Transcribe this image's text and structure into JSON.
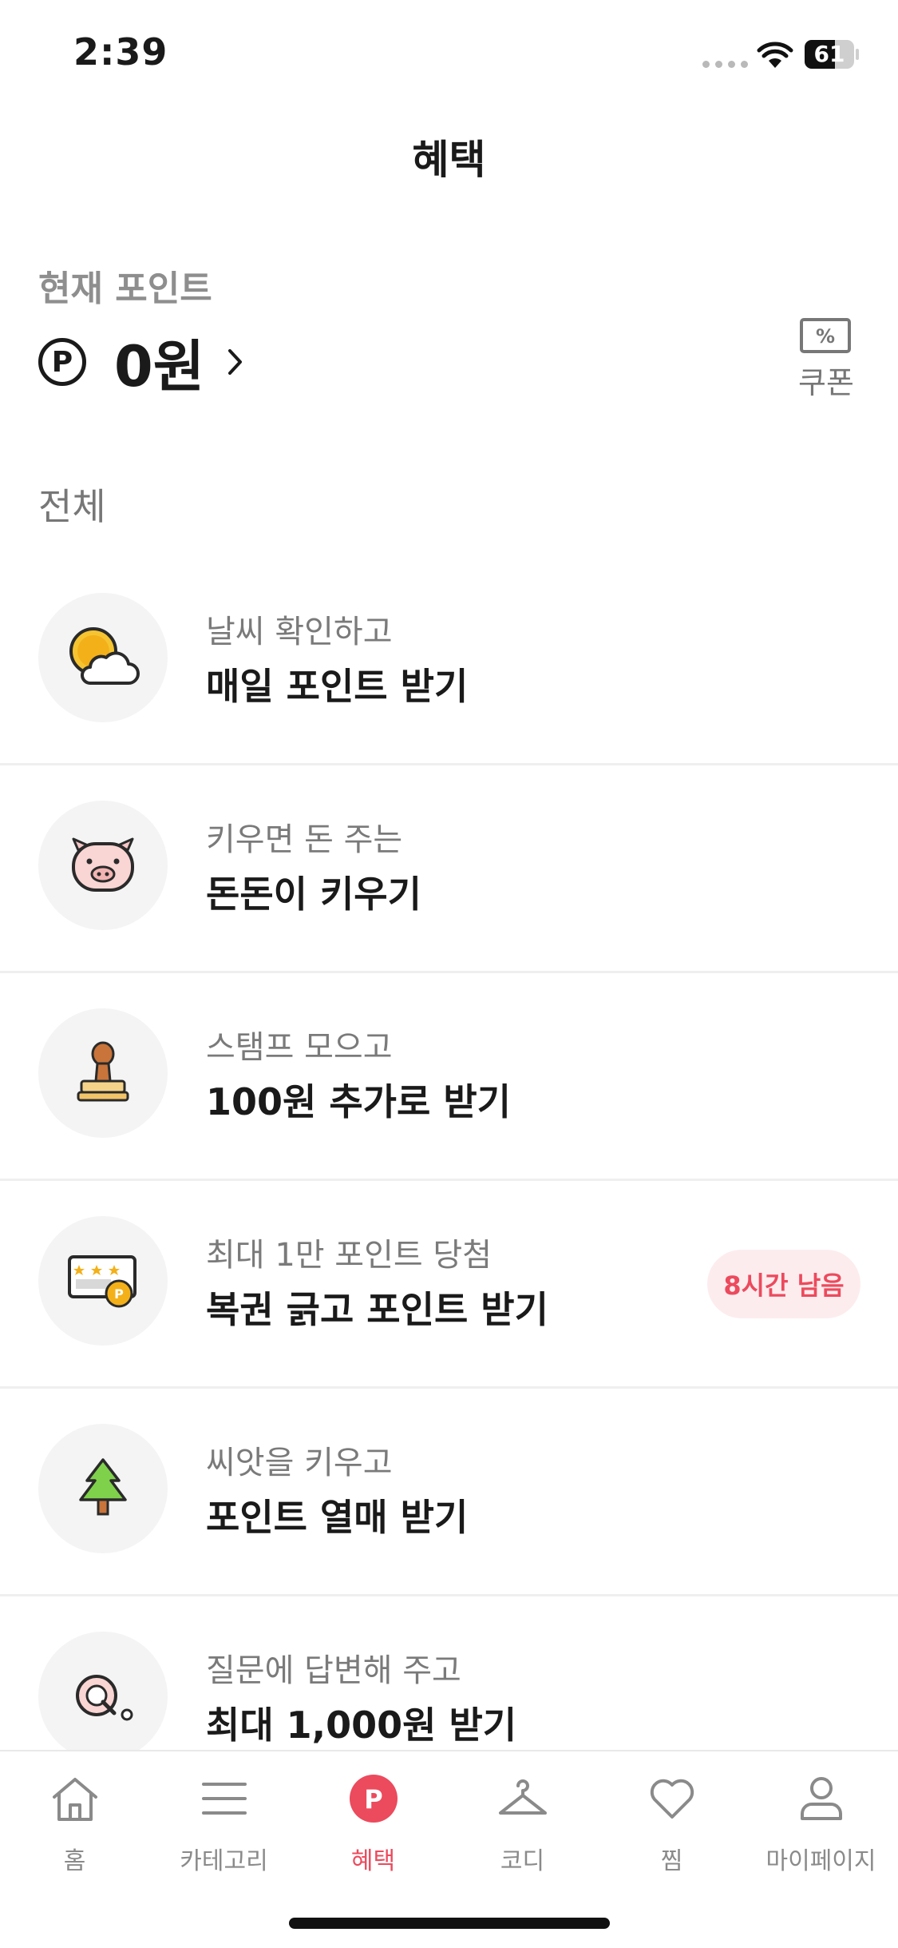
{
  "status_bar": {
    "time": "2:39",
    "battery": "61",
    "battery_level": 0.61
  },
  "header": {
    "title": "혜택"
  },
  "points": {
    "label": "현재 포인트",
    "symbol": "P",
    "value": "0원"
  },
  "coupon": {
    "label": "쿠폰",
    "icon_text": "%"
  },
  "section": {
    "title": "전체"
  },
  "items": [
    {
      "icon": "weather-sun-cloud-icon",
      "sub": "날씨 확인하고",
      "main": "매일 포인트 받기"
    },
    {
      "icon": "pig-icon",
      "sub": "키우면 돈 주는",
      "main": "돈돈이 키우기"
    },
    {
      "icon": "stamp-icon",
      "sub": "스탬프 모으고",
      "main": "100원 추가로 받기"
    },
    {
      "icon": "lottery-ticket-icon",
      "sub": "최대 1만 포인트 당첨",
      "main": "복권 긁고 포인트 받기",
      "badge": "8시간 남음"
    },
    {
      "icon": "tree-icon",
      "sub": "씨앗을 키우고",
      "main": "포인트 열매 받기"
    },
    {
      "icon": "question-q-icon",
      "sub": "질문에 답변해 주고",
      "main": "최대 1,000원 받기"
    }
  ],
  "nav": [
    {
      "label": "홈",
      "icon": "home-icon"
    },
    {
      "label": "카테고리",
      "icon": "menu-icon"
    },
    {
      "label": "혜택",
      "icon": "point-icon",
      "active": true,
      "icon_text": "P"
    },
    {
      "label": "코디",
      "icon": "hanger-icon"
    },
    {
      "label": "찜",
      "icon": "heart-icon"
    },
    {
      "label": "마이페이지",
      "icon": "user-icon"
    }
  ],
  "colors": {
    "accent": "#ec4a5d",
    "muted": "#8e8e8e",
    "badge_bg": "#fdecee"
  }
}
